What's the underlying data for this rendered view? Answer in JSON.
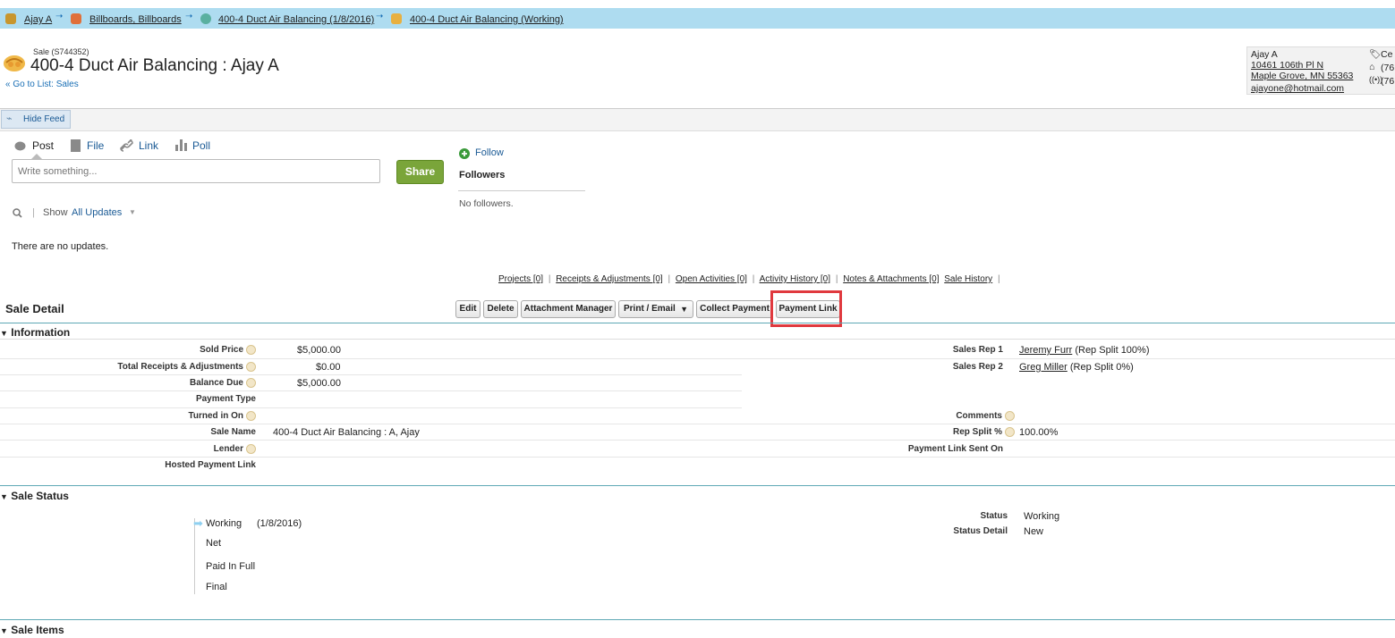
{
  "breadcrumb": [
    {
      "label": "Ajay A"
    },
    {
      "label": "Billboards, Billboards"
    },
    {
      "label": "400-4 Duct Air Balancing (1/8/2016)"
    },
    {
      "label": "400-4 Duct Air Balancing (Working)"
    }
  ],
  "record": {
    "type": "Sale (S744352)",
    "title": "400-4 Duct Air Balancing : Ajay A",
    "go_to_list": "« Go to List: Sales"
  },
  "contact": {
    "name": "Ajay A",
    "street": "10461 106th Pl N",
    "city": "Maple Grove, MN 55363",
    "email": "ajayone@hotmail.com",
    "right_lines": [
      "Ce",
      "(76",
      "(76"
    ]
  },
  "feed": {
    "hide_feed": "Hide Feed",
    "tabs": [
      "Post",
      "File",
      "Link",
      "Poll"
    ],
    "placeholder": "Write something...",
    "share": "Share",
    "follow": "Follow",
    "followers_title": "Followers",
    "no_followers": "No followers.",
    "show_label": "Show",
    "show_value": "All Updates",
    "no_updates": "There are no updates."
  },
  "related_links": [
    "Projects [0]",
    "Receipts & Adjustments [0]",
    "Open Activities [0]",
    "Activity History [0]",
    "Notes & Attachments [0]",
    "Sale History"
  ],
  "detail": {
    "title": "Sale Detail",
    "buttons": [
      "Edit",
      "Delete",
      "Attachment Manager",
      "Print / Email",
      "Collect Payment",
      "Payment Link"
    ],
    "print_caret": "▼"
  },
  "information": {
    "title": "Information",
    "left": [
      {
        "label": "Sold Price",
        "value": "$5,000.00"
      },
      {
        "label": "Total Receipts & Adjustments",
        "value": "$0.00"
      },
      {
        "label": "Balance Due",
        "value": "$5,000.00"
      },
      {
        "label": "Payment Type",
        "value": ""
      },
      {
        "label": "Turned in On",
        "value": ""
      },
      {
        "label": "Sale Name",
        "value": "400-4 Duct Air Balancing : A, Ajay"
      },
      {
        "label": "Lender",
        "value": ""
      },
      {
        "label": "Hosted Payment Link",
        "value": ""
      }
    ],
    "right": [
      {
        "label": "Sales Rep 1",
        "link": "Jeremy Furr",
        "value": " (Rep Split 100%)"
      },
      {
        "label": "Sales Rep 2",
        "link": "Greg Miller",
        "value": " (Rep Split 0%)"
      },
      {
        "label": "Comments",
        "link": "",
        "value": ""
      },
      {
        "label": "Rep Split %",
        "link": "",
        "value": "100.00%"
      },
      {
        "label": "Payment Link Sent On",
        "link": "",
        "value": ""
      }
    ]
  },
  "status_section": {
    "title": "Sale Status",
    "path": [
      {
        "label": "Working",
        "date": "(1/8/2016)"
      },
      {
        "label": "Net",
        "date": ""
      },
      {
        "label": "Paid In Full",
        "date": ""
      },
      {
        "label": "Final",
        "date": ""
      }
    ],
    "status_label": "Status",
    "status_value": "Working",
    "detail_label": "Status Detail",
    "detail_value": "New"
  },
  "items_section": {
    "title": "Sale Items"
  },
  "colors": {
    "breadcrumb_bg": "#aedcf0",
    "share_green": "#7aa53a",
    "highlight_red": "#e0393e",
    "section_rule": "#5ea8b5"
  }
}
